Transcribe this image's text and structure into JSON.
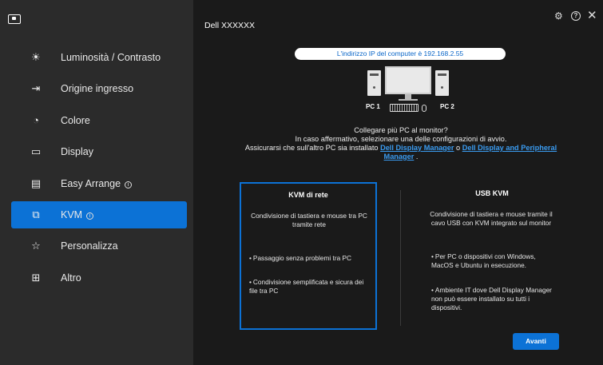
{
  "window": {
    "title": "Dell XXXXXX"
  },
  "sidebar": {
    "items": [
      {
        "label": "Luminosità / Contrasto",
        "icon": "brightness-icon",
        "active": false,
        "glyph": "☀"
      },
      {
        "label": "Origine ingresso",
        "icon": "input-source-icon",
        "active": false,
        "glyph": "⇥"
      },
      {
        "label": "Colore",
        "icon": "color-icon",
        "active": false,
        "glyph": "◔"
      },
      {
        "label": "Display",
        "icon": "display-icon",
        "active": false,
        "glyph": "▭"
      },
      {
        "label": "Easy Arrange",
        "icon": "easy-arrange-icon",
        "active": false,
        "glyph": "▤",
        "info": true
      },
      {
        "label": "KVM",
        "icon": "kvm-icon",
        "active": true,
        "glyph": "⧉",
        "info": true
      },
      {
        "label": "Personalizza",
        "icon": "star-icon",
        "active": false,
        "glyph": "☆"
      },
      {
        "label": "Altro",
        "icon": "other-icon",
        "active": false,
        "glyph": "⊞"
      }
    ]
  },
  "main": {
    "ip_banner": "L'indirizzo IP del computer è 192.168.2.55",
    "pc1_label": "PC 1",
    "pc2_label": "PC 2",
    "question_line1": "Collegare più PC al monitor?",
    "question_line2": "In caso affermativo, selezionare una delle configurazioni di avvio.",
    "question_line3": "Assicurarsi che sull'altro PC sia installato ",
    "link1": "Dell Display Manager",
    "or_text": " o ",
    "link2": "Dell Display and Peripheral Manager",
    "period": " .",
    "cards": [
      {
        "title": "KVM di rete",
        "description": "Condivisione di tastiera e mouse tra PC tramite rete",
        "bullets": [
          "Passaggio senza problemi tra PC",
          "Condivisione semplificata e sicura dei file tra PC"
        ],
        "selected": true
      },
      {
        "title": "USB KVM",
        "description": "Condivisione di tastiera e mouse tramite il cavo USB con KVM integrato sul monitor",
        "bullets": [
          "Per PC o dispositivi con Windows, MacOS e Ubuntu in esecuzione.",
          "Ambiente IT dove Dell Display Manager non può essere installato su tutti i dispositivi."
        ],
        "selected": false
      }
    ],
    "next_button": "Avanti"
  },
  "colors": {
    "accent": "#0c72d6",
    "sidebar_bg": "#2b2b2b",
    "main_bg": "#1a1a1a",
    "link": "#3a9bf0"
  }
}
